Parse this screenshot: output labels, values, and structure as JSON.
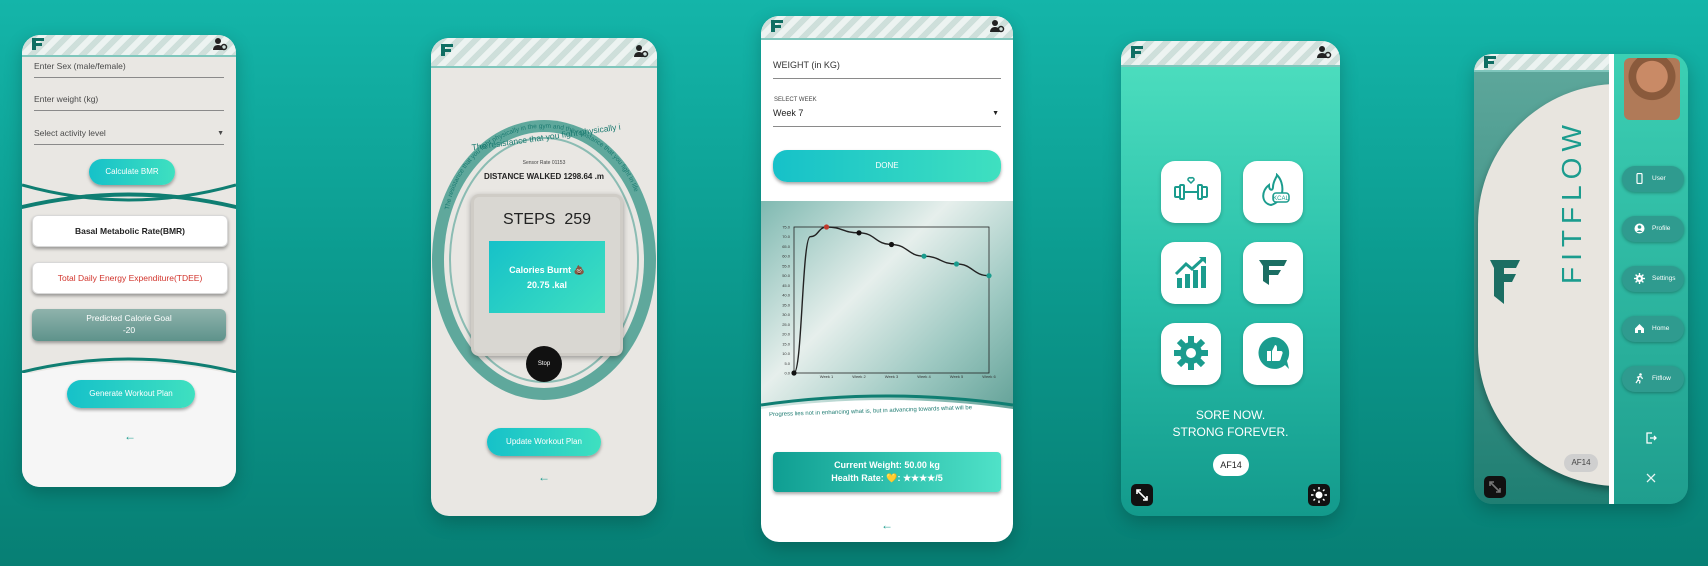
{
  "colors": {
    "teal": "#1b9c8e",
    "accent_red": "#d2342c",
    "dark": "#222"
  },
  "screen1": {
    "sex_label": "Enter Sex (male/female)",
    "weight_label": "Enter weight (kg)",
    "activity_label": "Select activity level",
    "calculate_btn": "Calculate BMR",
    "bmr_card": "Basal Metabolic Rate(BMR)",
    "tdee_card": "Total Daily Energy Expenditure(TDEE)",
    "goal_title": "Predicted Calorie Goal",
    "goal_value": "-20",
    "workout_btn": "Generate Workout Plan",
    "back_icon": "back-arrow-icon"
  },
  "screen2": {
    "quote": "The resistance that you fight physically in the gym and the resistance that you fight in life can only build a strong character",
    "sensor_rate": "Sensor Rate 01153",
    "distance": "DISTANCE WALKED 1298.64 .m",
    "steps_label": "STEPS",
    "steps_value": "259",
    "calories_label": "Calories Burnt 💩",
    "calories_value": "20.75 .kal",
    "stop_btn": "Stop",
    "update_btn": "Update Workout Plan"
  },
  "screen3": {
    "weight_label": "WEIGHT (in KG)",
    "week_caption": "SELECT WEEK",
    "week_value": "Week 7",
    "done_btn": "DONE",
    "motto": "Progress lies not in enhancing what is, but in advancing towards what will be",
    "current_weight": "Current Weight: 50.00 kg",
    "health_rate": "Health Rate: 💛: ★★★★/5"
  },
  "chart_data": {
    "type": "line",
    "categories": [
      "Week 1",
      "Week 2",
      "Week 3",
      "Week 4",
      "Week 5",
      "Week 6"
    ],
    "x": [
      0,
      0.5,
      1,
      2,
      3,
      4,
      5,
      6
    ],
    "values": [
      0,
      70,
      75,
      72,
      66,
      60,
      56,
      50
    ],
    "yticks": [
      "0.0",
      "5.0",
      "10.0",
      "15.0",
      "20.0",
      "25.0",
      "30.0",
      "35.0",
      "40.0",
      "45.0",
      "50.0",
      "55.0",
      "60.0",
      "65.0",
      "70.0",
      "75.0"
    ],
    "ylim": [
      0,
      75
    ]
  },
  "screen4": {
    "slogan_line1": "SORE NOW.",
    "slogan_line2": "STRONG FOREVER.",
    "badge": "AF14"
  },
  "screen5": {
    "brand": "FITFLOW",
    "badge": "AF14",
    "nav": [
      {
        "label": "User",
        "icon": "phone-icon"
      },
      {
        "label": "Profile",
        "icon": "account-icon"
      },
      {
        "label": "Settings",
        "icon": "gear-icon"
      },
      {
        "label": "Home",
        "icon": "home-icon"
      },
      {
        "label": "Fitflow",
        "icon": "runner-icon"
      }
    ]
  }
}
